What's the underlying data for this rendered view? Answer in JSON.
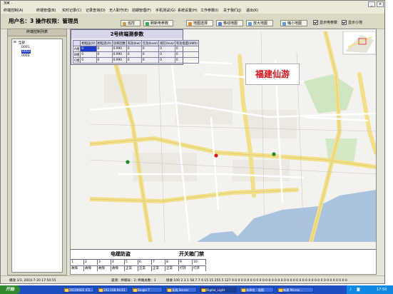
{
  "window": {
    "title": "ЭЖ ·"
  },
  "menu": [
    " 终端控制(A)",
    "终端管理(B)",
    "实时记录(C)",
    "记录查询(D)",
    "无人职守(E)",
    "前期管理(F)",
    "手机测试(G)",
    "系统设置(H)",
    "工作参数(I)",
    "关于我们(J)",
    "退出(K)"
  ],
  "toolbar": {
    "user_label": "用户名：3  操作权限：管理员",
    "buttons": [
      {
        "label": "巡控",
        "icon": "patrol-icon",
        "color": "#c8a048"
      },
      {
        "label": "刷新电参数",
        "icon": "refresh-icon",
        "color": "#3aa858"
      },
      {
        "label": "地图选择",
        "icon": "map-select-icon",
        "color": "#d98b2b"
      },
      {
        "label": "移动地图",
        "icon": "move-map-icon",
        "color": "#4d7bd6"
      },
      {
        "label": "放大地图",
        "icon": "zoom-in-icon",
        "color": "#5a9bd5"
      },
      {
        "label": "缩小地图",
        "icon": "zoom-out-icon",
        "color": "#5a9bd5"
      }
    ],
    "checkboxes": [
      {
        "label": "显示电参数",
        "checked": true
      },
      {
        "label": "显示小地",
        "checked": true
      }
    ]
  },
  "left_panel": {
    "title": "终端控制列表",
    "tree": [
      "全部",
      "0001",
      "0002",
      "0003"
    ]
  },
  "param_window": {
    "title": "2号终端测参数",
    "headers": [
      "",
      "相电压(V)",
      "相电流(A)",
      "功率因数",
      "有功(kw)",
      "无功(kvar)",
      "视在(kva)",
      "有功电度(kWh)"
    ],
    "rows": [
      [
        "A相",
        "0",
        "0",
        "0.990",
        "0",
        "0",
        "0",
        "0"
      ],
      [
        "B相",
        "0",
        "0",
        "0.990",
        "0",
        "0",
        "0",
        "0"
      ],
      [
        "C相",
        "0",
        "0",
        "0.990",
        "0",
        "0",
        "0",
        "0"
      ]
    ]
  },
  "map": {
    "banner": "福建仙游"
  },
  "cable_panel": {
    "title1": "电缆防盗",
    "title2": "开关箱门禁",
    "numbers": [
      "1",
      "2",
      "3",
      "4",
      "5",
      "6",
      "7",
      "8",
      "9",
      "10"
    ],
    "statuses": [
      "故障",
      "故障",
      "故障",
      "故障",
      "正常",
      "正常",
      "正常",
      "正常",
      "打开",
      "打开"
    ]
  },
  "statusbar": {
    "left": "播放 3/3, 2010-7-20  17:50:55",
    "mid": "遥测：终端号：2; 终端总数：3",
    "right": "接收  100 2 3 1 58 7 7 0 15 15 255 5 127 0 0 0 0 0 0 0 0 0 0 0 0 0 0 0 0 0 0 0 0 0 0 0 0 0 0 0 0 0 0 0 0 0 0 0 0 0 0"
  },
  "taskbar": {
    "start": "开始",
    "tasks": [
      "20100602 ICS...",
      "192.168.94.61",
      "Beigbi T",
      "无线 Server",
      "Digital_Light",
      "未命名 - 画图",
      "新建 Micros..."
    ],
    "clock": "17:50"
  }
}
